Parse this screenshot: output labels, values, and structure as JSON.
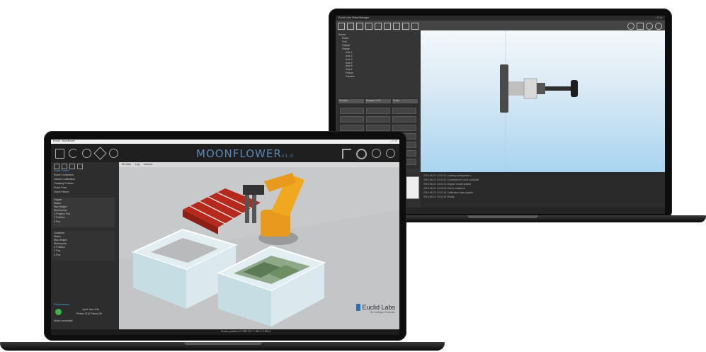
{
  "back_app": {
    "title": "Euclid Labs Robot Manager",
    "tree_items": [
      "Scene",
      "Robot",
      "Tool",
      "Gripper",
      "Flange",
      "Axis 1",
      "Axis 2",
      "Axis 3",
      "Axis 4",
      "Axis 5",
      "Axis 6",
      "Fixture",
      "Camera"
    ],
    "table_headers": [
      "Position",
      "Rotation XYZ",
      "Scale"
    ],
    "log_lines": [
      "2019-06-21 10:32:11 Loading configuration...",
      "2019-06-21 10:32:12 Connected to robot controller",
      "2019-06-21 10:32:12 Gripper model loaded",
      "2019-06-21 10:32:13 Scene initialized",
      "2019-06-21 10:32:14 Calibration data applied",
      "2019-06-21 10:32:14 Ready"
    ]
  },
  "front_app": {
    "window_title": "Euclid - Moonflower",
    "logo": "MOONFLOWER",
    "logo_version": "v1.0",
    "view_tabs": [
      "3D View",
      "Log",
      "Camera"
    ],
    "left_panel": {
      "header": "Robot Control",
      "items": [
        "Robot Connection",
        "Camera Calibration",
        "Grasping Position",
        "Robot Pose",
        "Vision Picture"
      ],
      "group1": [
        "Gripper",
        "Status",
        "Max Weight",
        "Dimensions",
        "X Position Pos",
        "Y Position",
        "Z Pos"
      ],
      "group2": [
        "Container",
        "Status",
        "Max Weight",
        "Dimensions",
        "X Position",
        "Y Pos",
        "Z Pos"
      ],
      "bottom_header": "Performances",
      "bottom_items": [
        "Cycle time 4.5s",
        "Picked 1234 Placed 98"
      ],
      "bottom_status": "Robot connected"
    },
    "status_bar": "Cursor position: X 1285.724  Y -461.2  Z 230.4",
    "brand": "Euclid Labs",
    "brand_sub": "Be Intelligent Robotics"
  },
  "colors": {
    "accent_orange": "#e89a1e",
    "pallet_red": "#b52a1c",
    "sky_blue": "#a9d4f0",
    "panel_dark": "#2b2b2b",
    "logo_blue": "#2c6fb8"
  }
}
